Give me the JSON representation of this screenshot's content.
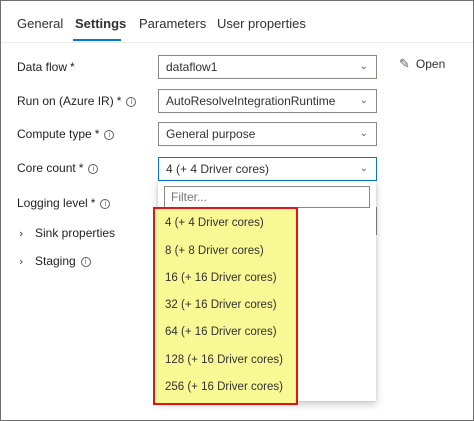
{
  "tabs": [
    "General",
    "Settings",
    "Parameters",
    "User properties"
  ],
  "active_tab": "Settings",
  "fields": {
    "data_flow": {
      "label": "Data flow",
      "required": "*",
      "value": "dataflow1"
    },
    "run_on": {
      "label": "Run on (Azure IR)",
      "required": "*",
      "value": "AutoResolveIntegrationRuntime"
    },
    "compute_type": {
      "label": "Compute type",
      "required": "*",
      "value": "General purpose"
    },
    "core_count": {
      "label": "Core count",
      "required": "*",
      "value": "4 (+ 4 Driver cores)"
    },
    "logging_level": {
      "label": "Logging level",
      "required": "*"
    }
  },
  "open_label": "Open",
  "expanders": {
    "sink": "Sink properties",
    "staging": "Staging"
  },
  "dropdown": {
    "filter_placeholder": "Filter...",
    "options": [
      "4 (+ 4 Driver cores)",
      "8 (+ 8 Driver cores)",
      "16 (+ 16 Driver cores)",
      "32 (+ 16 Driver cores)",
      "64 (+ 16 Driver cores)",
      "128 (+ 16 Driver cores)",
      "256 (+ 16 Driver cores)"
    ]
  },
  "icons": {
    "info": "info-icon",
    "chevron": "chevron-down-icon",
    "edit": "pencil-icon",
    "expand": "chevron-right-icon"
  },
  "colors": {
    "accent": "#0078d4",
    "highlight_fill": "#f8f994",
    "highlight_border": "#e0141a"
  }
}
